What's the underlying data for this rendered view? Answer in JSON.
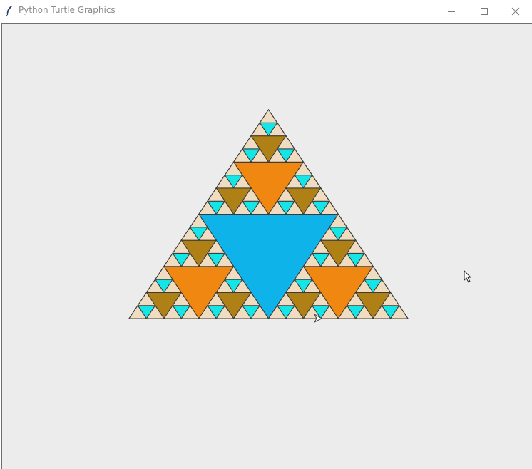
{
  "window": {
    "title": "Python Turtle Graphics",
    "buttons": {
      "minimize_icon": "minimize-icon",
      "maximize_icon": "maximize-icon",
      "close_icon": "close-icon"
    }
  },
  "canvas": {
    "background": "#ececec"
  },
  "figure": {
    "type": "sierpinski-triangle",
    "depth": 4,
    "colors_by_level": [
      "#0eb4e9",
      "#ef8710",
      "#ae8015",
      "#14e6e8",
      "#f0dcc0"
    ],
    "outline": "#3a3a3a"
  },
  "cursors": {
    "turtle": "turtle-arrow-icon",
    "mouse": "mouse-pointer-icon"
  }
}
